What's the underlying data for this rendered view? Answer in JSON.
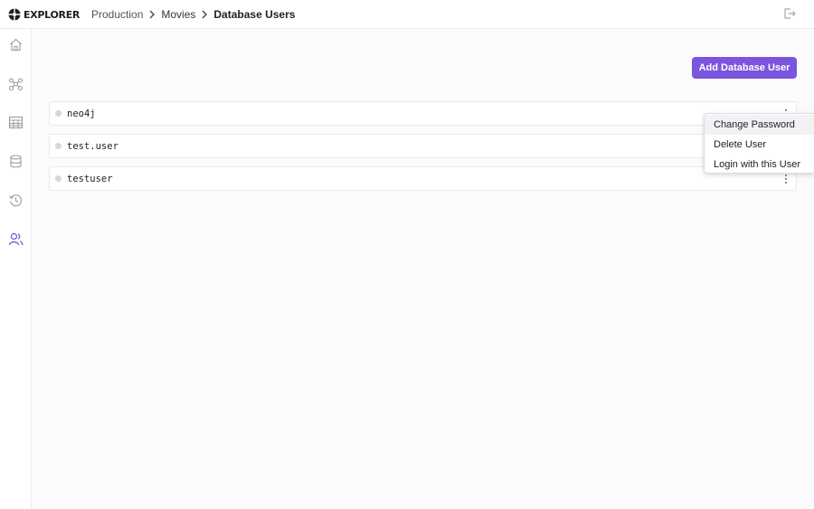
{
  "app": {
    "logo_text": "EXPLORER"
  },
  "breadcrumb": [
    {
      "label": "Production"
    },
    {
      "label": "Movies"
    },
    {
      "label": "Database Users"
    }
  ],
  "header": {
    "logout_icon": "logout-icon"
  },
  "sidebar": {
    "items": [
      {
        "name": "home",
        "icon": "home-icon"
      },
      {
        "name": "graph",
        "icon": "graph-icon"
      },
      {
        "name": "table",
        "icon": "table-icon"
      },
      {
        "name": "database",
        "icon": "database-icon"
      },
      {
        "name": "history",
        "icon": "history-icon"
      },
      {
        "name": "users",
        "icon": "users-icon",
        "active": true
      }
    ],
    "active_color": "#6b4fd6"
  },
  "main": {
    "add_button_label": "Add Database User",
    "accent_color": "#7b55dd",
    "users": [
      {
        "name": "neo4j"
      },
      {
        "name": "test.user"
      },
      {
        "name": "testuser"
      }
    ]
  },
  "context_menu": {
    "open_for_row": 0,
    "items": [
      {
        "label": "Change Password",
        "hover": true
      },
      {
        "label": "Delete User"
      },
      {
        "label": "Login with this User"
      }
    ]
  }
}
